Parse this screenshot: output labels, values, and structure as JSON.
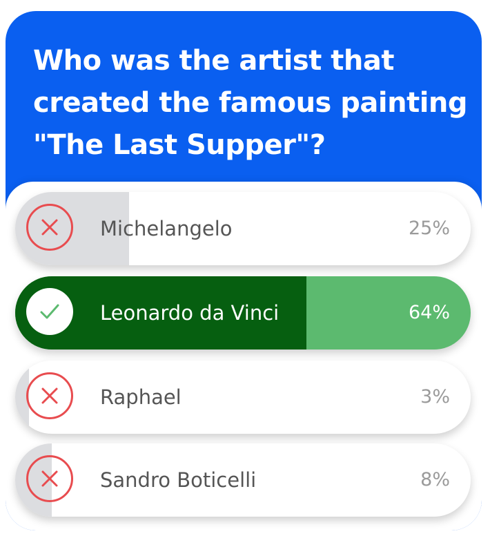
{
  "question": "Who was the artist that created the famous painting \"The Last Supper\"?",
  "colors": {
    "header_background": "#0a5ff0",
    "correct_fill": "#065f10",
    "correct_track": "#5cba6f",
    "wrong_fill": "#dcdde0",
    "wrong_icon": "#e84c4f",
    "correct_icon": "#5cba6f"
  },
  "options": [
    {
      "label": "Michelangelo",
      "percent_text": "25%",
      "percent": 25,
      "correct": false,
      "icon": "close-icon"
    },
    {
      "label": "Leonardo da Vinci",
      "percent_text": "64%",
      "percent": 64,
      "correct": true,
      "icon": "check-icon"
    },
    {
      "label": "Raphael",
      "percent_text": "3%",
      "percent": 3,
      "correct": false,
      "icon": "close-icon"
    },
    {
      "label": "Sandro Boticelli",
      "percent_text": "8%",
      "percent": 8,
      "correct": false,
      "icon": "close-icon"
    }
  ]
}
